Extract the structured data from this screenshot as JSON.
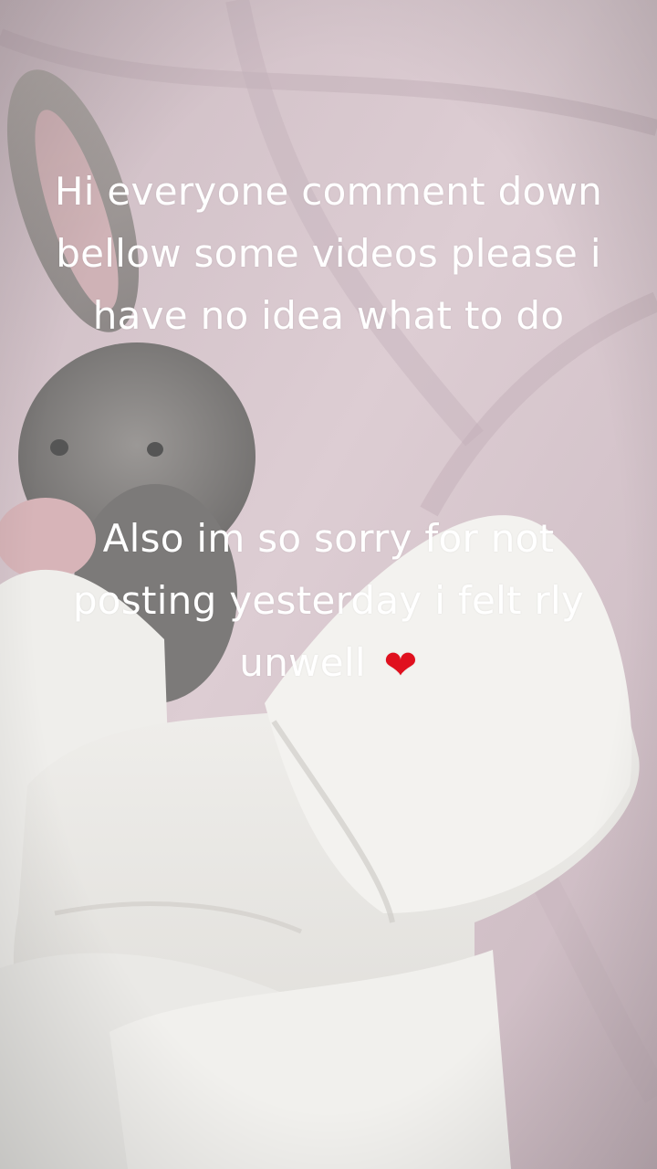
{
  "overlay_text": {
    "paragraph_1": "Hi everyone comment down bellow some videos please i have no idea what to do",
    "paragraph_2": "Also im so sorry for not posting yesterday i felt rly unwell",
    "heart_emoji": "❤"
  },
  "colors": {
    "text": "#ffffff",
    "heart": "#e0101e",
    "bedding_pink": "#d9c9cf",
    "blanket_white": "#ecebe8",
    "bunny_grey": "#8f8d8b"
  },
  "icons": [
    "heart-icon"
  ]
}
